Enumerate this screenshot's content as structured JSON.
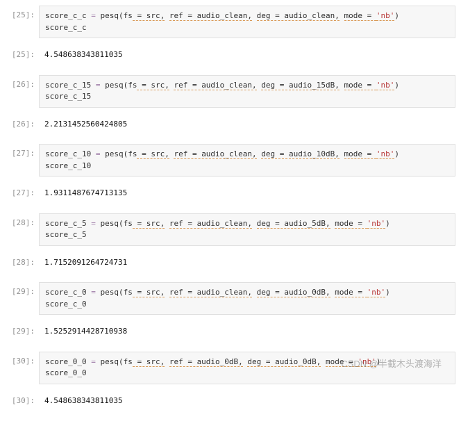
{
  "cells": [
    {
      "prompt_in": "[25]:",
      "code_tokens": [
        {
          "t": "score_c_c ",
          "c": "tk-var"
        },
        {
          "t": "=",
          "c": "tk-op"
        },
        {
          "t": " pesq(fs",
          "c": "tk-func"
        },
        {
          "t": " = src,",
          "c": "tk-kw"
        },
        {
          "t": " ",
          "c": ""
        },
        {
          "t": "ref = audio_clean,",
          "c": "tk-kw"
        },
        {
          "t": " ",
          "c": ""
        },
        {
          "t": "deg = audio_clean,",
          "c": "tk-kw"
        },
        {
          "t": " ",
          "c": ""
        },
        {
          "t": "mode = ",
          "c": "tk-kw"
        },
        {
          "t": "'nb'",
          "c": "tk-str"
        },
        {
          "t": ")",
          "c": "tk-func"
        },
        {
          "t": "\n",
          "c": ""
        },
        {
          "t": "score_c_c",
          "c": "tk-var"
        }
      ],
      "prompt_out": "[25]:",
      "output": "4.548638343811035"
    },
    {
      "prompt_in": "[26]:",
      "code_tokens": [
        {
          "t": "score_c_15 ",
          "c": "tk-var"
        },
        {
          "t": "=",
          "c": "tk-op"
        },
        {
          "t": " pesq(fs",
          "c": "tk-func"
        },
        {
          "t": " = src,",
          "c": "tk-kw"
        },
        {
          "t": " ",
          "c": ""
        },
        {
          "t": "ref = audio_clean,",
          "c": "tk-kw"
        },
        {
          "t": " ",
          "c": ""
        },
        {
          "t": "deg = audio_15dB,",
          "c": "tk-kw"
        },
        {
          "t": " ",
          "c": ""
        },
        {
          "t": "mode = ",
          "c": "tk-kw"
        },
        {
          "t": "'nb'",
          "c": "tk-str"
        },
        {
          "t": ")",
          "c": "tk-func"
        },
        {
          "t": "\n",
          "c": ""
        },
        {
          "t": "score_c_15",
          "c": "tk-var"
        }
      ],
      "prompt_out": "[26]:",
      "output": "2.2131452560424805"
    },
    {
      "prompt_in": "[27]:",
      "code_tokens": [
        {
          "t": "score_c_10 ",
          "c": "tk-var"
        },
        {
          "t": "=",
          "c": "tk-op"
        },
        {
          "t": " pesq(fs",
          "c": "tk-func"
        },
        {
          "t": " = src,",
          "c": "tk-kw"
        },
        {
          "t": " ",
          "c": ""
        },
        {
          "t": "ref = audio_clean,",
          "c": "tk-kw"
        },
        {
          "t": " ",
          "c": ""
        },
        {
          "t": "deg = audio_10dB,",
          "c": "tk-kw"
        },
        {
          "t": " ",
          "c": ""
        },
        {
          "t": "mode = ",
          "c": "tk-kw"
        },
        {
          "t": "'nb'",
          "c": "tk-str"
        },
        {
          "t": ")",
          "c": "tk-func"
        },
        {
          "t": "\n",
          "c": ""
        },
        {
          "t": "score_c_10",
          "c": "tk-var"
        }
      ],
      "prompt_out": "[27]:",
      "output": "1.9311487674713135"
    },
    {
      "prompt_in": "[28]:",
      "code_tokens": [
        {
          "t": "score_c_5 ",
          "c": "tk-var"
        },
        {
          "t": "=",
          "c": "tk-op"
        },
        {
          "t": " pesq(fs",
          "c": "tk-func"
        },
        {
          "t": " = src,",
          "c": "tk-kw"
        },
        {
          "t": " ",
          "c": ""
        },
        {
          "t": "ref = audio_clean,",
          "c": "tk-kw"
        },
        {
          "t": " ",
          "c": ""
        },
        {
          "t": "deg = audio_5dB,",
          "c": "tk-kw"
        },
        {
          "t": " ",
          "c": ""
        },
        {
          "t": "mode = ",
          "c": "tk-kw"
        },
        {
          "t": "'nb'",
          "c": "tk-str"
        },
        {
          "t": ")",
          "c": "tk-func"
        },
        {
          "t": "\n",
          "c": ""
        },
        {
          "t": "score_c_5",
          "c": "tk-var"
        }
      ],
      "prompt_out": "[28]:",
      "output": "1.7152091264724731"
    },
    {
      "prompt_in": "[29]:",
      "code_tokens": [
        {
          "t": "score_c_0 ",
          "c": "tk-var"
        },
        {
          "t": "=",
          "c": "tk-op"
        },
        {
          "t": " pesq(fs",
          "c": "tk-func"
        },
        {
          "t": " = src,",
          "c": "tk-kw"
        },
        {
          "t": " ",
          "c": ""
        },
        {
          "t": "ref = audio_clean,",
          "c": "tk-kw"
        },
        {
          "t": " ",
          "c": ""
        },
        {
          "t": "deg = audio_0dB,",
          "c": "tk-kw"
        },
        {
          "t": " ",
          "c": ""
        },
        {
          "t": "mode = ",
          "c": "tk-kw"
        },
        {
          "t": "'nb'",
          "c": "tk-str"
        },
        {
          "t": ")",
          "c": "tk-func"
        },
        {
          "t": "\n",
          "c": ""
        },
        {
          "t": "score_c_0",
          "c": "tk-var"
        }
      ],
      "prompt_out": "[29]:",
      "output": "1.5252914428710938"
    },
    {
      "prompt_in": "[30]:",
      "code_tokens": [
        {
          "t": "score_0_0 ",
          "c": "tk-var"
        },
        {
          "t": "=",
          "c": "tk-op"
        },
        {
          "t": " pesq(fs",
          "c": "tk-func"
        },
        {
          "t": " = src,",
          "c": "tk-kw"
        },
        {
          "t": " ",
          "c": ""
        },
        {
          "t": "ref = audio_0dB,",
          "c": "tk-kw"
        },
        {
          "t": " ",
          "c": ""
        },
        {
          "t": "deg = audio_0dB,",
          "c": "tk-kw"
        },
        {
          "t": " ",
          "c": ""
        },
        {
          "t": "mode = ",
          "c": "tk-kw"
        },
        {
          "t": "'nb'",
          "c": "tk-str"
        },
        {
          "t": ")",
          "c": "tk-func"
        },
        {
          "t": "\n",
          "c": ""
        },
        {
          "t": "score_0_0",
          "c": "tk-var"
        }
      ],
      "prompt_out": "[30]:",
      "output": "4.548638343811035"
    }
  ],
  "watermark": "CSDN @半截木头渡海洋"
}
